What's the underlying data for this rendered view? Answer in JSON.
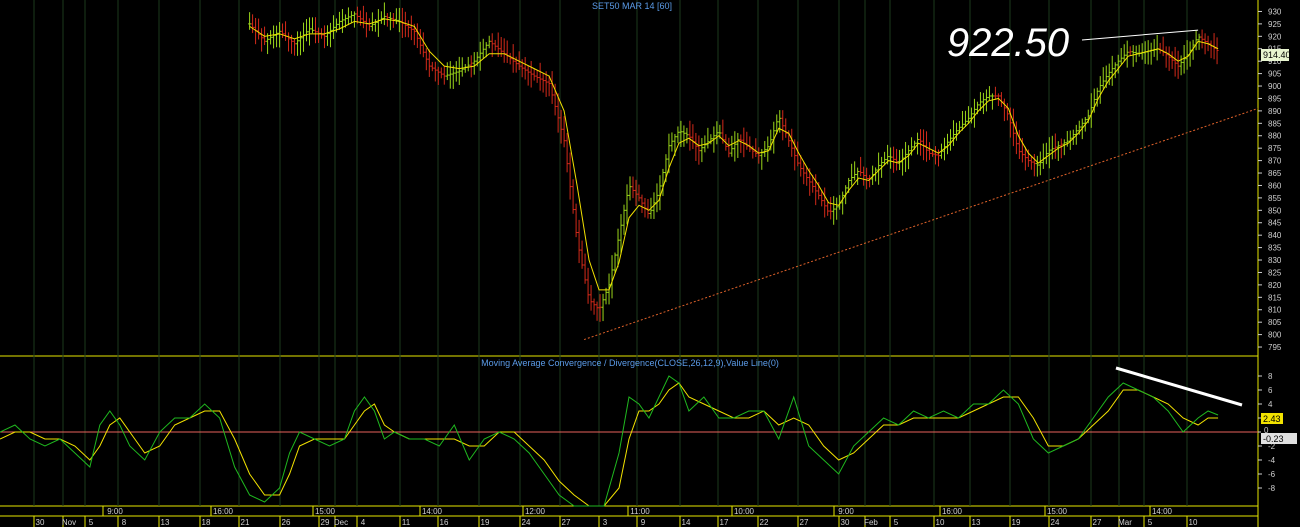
{
  "price_panel": {
    "title": "SET50 MAR 14  [60]",
    "last_value": "914.40",
    "annotation": "922.50"
  },
  "macd_panel": {
    "title": "Moving Average Convergence / Divergence(CLOSE,26,12,9),Value Line(0)",
    "macd_value": "2.43",
    "signal_value": "0",
    "hist_value": "-0.23"
  },
  "colors": {
    "background": "#000000",
    "up_bar": "#9ad51a",
    "down_bar": "#d42a1a",
    "ma_line": "#f2e200",
    "trendline": "#e0622a",
    "macd_line": "#1fb81f",
    "signal_line": "#f2e200",
    "zero_line": "#e8625c",
    "panel_border": "#e6e600",
    "grid": "#1c3a1c",
    "axis_text": "#d0d0d0",
    "title_text": "#5b9be8"
  },
  "chart_data": [
    {
      "type": "line",
      "title": "SET50 MAR 14  [60]",
      "y_ticks": [
        795,
        800,
        805,
        810,
        815,
        820,
        825,
        830,
        835,
        840,
        845,
        850,
        855,
        860,
        865,
        870,
        875,
        880,
        885,
        890,
        895,
        900,
        905,
        910,
        915,
        920,
        925,
        930
      ],
      "ylim": [
        793,
        933
      ],
      "x_domain": [
        0,
        1260
      ],
      "series": [
        {
          "name": "",
          "role": "close",
          "x": [
            250,
            265,
            280,
            295,
            310,
            325,
            340,
            355,
            370,
            385,
            400,
            415,
            430,
            445,
            460,
            475,
            490,
            505,
            520,
            535,
            550,
            565,
            578,
            590,
            600,
            610,
            620,
            630,
            640,
            650,
            660,
            670,
            680,
            690,
            700,
            710,
            720,
            730,
            740,
            750,
            760,
            770,
            780,
            790,
            800,
            810,
            820,
            830,
            840,
            850,
            860,
            870,
            880,
            890,
            900,
            910,
            920,
            930,
            940,
            950,
            960,
            970,
            980,
            990,
            1000,
            1010,
            1020,
            1030,
            1040,
            1050,
            1060,
            1070,
            1080,
            1090,
            1100,
            1110,
            1120,
            1130,
            1140,
            1150,
            1160,
            1170,
            1180,
            1190,
            1200,
            1210,
            1220
          ],
          "y": [
            925,
            918,
            922,
            917,
            923,
            920,
            926,
            929,
            924,
            928,
            926,
            922,
            908,
            904,
            906,
            910,
            918,
            913,
            908,
            904,
            901,
            878,
            838,
            814,
            810,
            820,
            840,
            860,
            855,
            848,
            858,
            876,
            882,
            880,
            874,
            878,
            882,
            873,
            879,
            875,
            872,
            876,
            888,
            878,
            868,
            862,
            856,
            849,
            852,
            862,
            866,
            862,
            868,
            872,
            869,
            874,
            879,
            873,
            872,
            878,
            883,
            887,
            893,
            896,
            896,
            888,
            874,
            870,
            868,
            874,
            876,
            878,
            883,
            888,
            899,
            905,
            910,
            914,
            913,
            914,
            915,
            912,
            908,
            913,
            920,
            917,
            914
          ]
        },
        {
          "name": "",
          "role": "moving-average",
          "x": [
            250,
            265,
            280,
            295,
            310,
            325,
            340,
            355,
            370,
            385,
            400,
            415,
            430,
            445,
            460,
            475,
            490,
            505,
            520,
            535,
            550,
            565,
            578,
            590,
            600,
            610,
            620,
            630,
            640,
            650,
            660,
            670,
            680,
            690,
            700,
            710,
            720,
            730,
            740,
            750,
            760,
            770,
            780,
            790,
            800,
            810,
            820,
            830,
            840,
            850,
            860,
            870,
            880,
            890,
            900,
            910,
            920,
            930,
            940,
            950,
            960,
            970,
            980,
            990,
            1000,
            1010,
            1020,
            1030,
            1040,
            1050,
            1060,
            1070,
            1080,
            1090,
            1100,
            1110,
            1120,
            1130,
            1140,
            1150,
            1160,
            1170,
            1180,
            1190,
            1200,
            1210,
            1220
          ],
          "y": [
            924,
            920,
            921,
            919,
            921,
            921,
            923,
            926,
            925,
            927,
            926,
            924,
            914,
            908,
            907,
            908,
            913,
            913,
            910,
            907,
            904,
            890,
            860,
            830,
            818,
            818,
            829,
            847,
            852,
            850,
            854,
            867,
            877,
            879,
            876,
            877,
            880,
            876,
            878,
            876,
            873,
            874,
            883,
            881,
            873,
            866,
            860,
            853,
            852,
            858,
            863,
            862,
            866,
            870,
            869,
            872,
            877,
            875,
            873,
            876,
            881,
            885,
            890,
            894,
            895,
            891,
            880,
            873,
            869,
            872,
            875,
            877,
            881,
            886,
            895,
            902,
            907,
            912,
            913,
            914,
            915,
            913,
            910,
            912,
            918,
            917,
            915
          ]
        },
        {
          "name": "",
          "role": "trendline",
          "x": [
            585,
            1260
          ],
          "y": [
            798,
            891
          ]
        }
      ]
    },
    {
      "type": "line",
      "title": "Moving Average Convergence / Divergence(CLOSE,26,12,9),Value Line(0)",
      "y_ticks": [
        -8,
        -6,
        -4,
        -2,
        0,
        2,
        4,
        6,
        8
      ],
      "ylim": [
        -10,
        10
      ],
      "x_domain": [
        0,
        1260
      ],
      "series": [
        {
          "name": "",
          "role": "macd",
          "x": [
            0,
            15,
            30,
            45,
            60,
            75,
            90,
            100,
            110,
            120,
            130,
            145,
            160,
            175,
            190,
            205,
            220,
            235,
            250,
            265,
            280,
            290,
            300,
            315,
            330,
            345,
            355,
            365,
            375,
            385,
            395,
            410,
            425,
            440,
            455,
            470,
            485,
            500,
            515,
            530,
            545,
            560,
            575,
            590,
            605,
            620,
            630,
            640,
            650,
            660,
            670,
            680,
            690,
            705,
            720,
            735,
            750,
            765,
            780,
            795,
            810,
            825,
            840,
            855,
            870,
            885,
            900,
            915,
            930,
            945,
            960,
            975,
            990,
            1005,
            1020,
            1035,
            1050,
            1065,
            1080,
            1095,
            1110,
            1125,
            1140,
            1155,
            1170,
            1185,
            1200,
            1210,
            1220
          ],
          "y": [
            0,
            1,
            -1,
            -2,
            -1,
            -3,
            -5,
            1,
            3,
            1,
            -2,
            -4,
            0,
            2,
            2,
            4,
            2,
            -5,
            -9,
            -10,
            -8,
            -3,
            0,
            -1,
            -2,
            -1,
            3,
            5,
            3,
            -1,
            0,
            -1,
            -1,
            -2,
            1,
            -4,
            -1,
            0,
            -1,
            -3,
            -6,
            -9,
            -11,
            -13,
            -12,
            -3,
            5,
            4,
            2,
            5,
            8,
            7,
            3,
            5,
            2,
            2,
            3,
            3,
            -1,
            5,
            -2,
            -4,
            -6,
            -2,
            0,
            2,
            1,
            3,
            2,
            3,
            2,
            4,
            4,
            6,
            4,
            -1,
            -3,
            -2,
            -1,
            2,
            5,
            7,
            6,
            5,
            3,
            0,
            2,
            3,
            2.43
          ]
        },
        {
          "name": "",
          "role": "signal",
          "x": [
            0,
            15,
            30,
            45,
            60,
            75,
            90,
            100,
            110,
            120,
            130,
            145,
            160,
            175,
            190,
            205,
            220,
            235,
            250,
            265,
            280,
            290,
            300,
            315,
            330,
            345,
            355,
            365,
            375,
            385,
            395,
            410,
            425,
            440,
            455,
            470,
            485,
            500,
            515,
            530,
            545,
            560,
            575,
            590,
            605,
            620,
            630,
            640,
            650,
            660,
            670,
            680,
            690,
            705,
            720,
            735,
            750,
            765,
            780,
            795,
            810,
            825,
            840,
            855,
            870,
            885,
            900,
            915,
            930,
            945,
            960,
            975,
            990,
            1005,
            1020,
            1035,
            1050,
            1065,
            1080,
            1095,
            1110,
            1125,
            1140,
            1155,
            1170,
            1185,
            1200,
            1210,
            1220
          ],
          "y": [
            -1,
            0,
            0,
            -1,
            -1,
            -2,
            -4,
            -2,
            1,
            2,
            0,
            -3,
            -2,
            1,
            2,
            3,
            3,
            -1,
            -6,
            -9,
            -9,
            -6,
            -2,
            -1,
            -1,
            -1,
            1,
            3,
            4,
            1,
            0,
            -1,
            -1,
            -1,
            -1,
            -2,
            -2,
            0,
            0,
            -2,
            -4,
            -7,
            -9,
            -11,
            -12,
            -8,
            -1,
            3,
            3,
            4,
            6,
            7,
            5,
            4,
            3,
            2,
            2,
            3,
            1,
            2,
            1,
            -2,
            -4,
            -3,
            -1,
            1,
            1,
            2,
            2,
            2,
            2,
            3,
            4,
            5,
            5,
            2,
            -2,
            -2,
            -1,
            1,
            3,
            6,
            6,
            5,
            4,
            2,
            1,
            2,
            2
          ]
        }
      ],
      "zero_line": 0
    }
  ],
  "date_axis": {
    "labels": [
      {
        "x": 40,
        "text": "30"
      },
      {
        "x": 69,
        "text": "Nov"
      },
      {
        "x": 91,
        "text": "5"
      },
      {
        "x": 124,
        "text": "8"
      },
      {
        "x": 165,
        "text": "13"
      },
      {
        "x": 206,
        "text": "18"
      },
      {
        "x": 245,
        "text": "21"
      },
      {
        "x": 286,
        "text": "26"
      },
      {
        "x": 325,
        "text": "29"
      },
      {
        "x": 341,
        "text": "Dec"
      },
      {
        "x": 363,
        "text": "4"
      },
      {
        "x": 406,
        "text": "11"
      },
      {
        "x": 444,
        "text": "16"
      },
      {
        "x": 485,
        "text": "19"
      },
      {
        "x": 526,
        "text": "24"
      },
      {
        "x": 566,
        "text": "27"
      },
      {
        "x": 605,
        "text": "3"
      },
      {
        "x": 643,
        "text": "9"
      },
      {
        "x": 686,
        "text": "14"
      },
      {
        "x": 724,
        "text": "17"
      },
      {
        "x": 764,
        "text": "22"
      },
      {
        "x": 804,
        "text": "27"
      },
      {
        "x": 845,
        "text": "30"
      },
      {
        "x": 871,
        "text": "Feb"
      },
      {
        "x": 896,
        "text": "5"
      },
      {
        "x": 940,
        "text": "10"
      },
      {
        "x": 976,
        "text": "13"
      },
      {
        "x": 1016,
        "text": "19"
      },
      {
        "x": 1055,
        "text": "24"
      },
      {
        "x": 1097,
        "text": "27"
      },
      {
        "x": 1125,
        "text": "Mar"
      },
      {
        "x": 1150,
        "text": "5"
      },
      {
        "x": 1193,
        "text": "10"
      }
    ],
    "time_labels": [
      {
        "x": 115,
        "text": "9:00"
      },
      {
        "x": 223,
        "text": "16:00"
      },
      {
        "x": 325,
        "text": "15:00"
      },
      {
        "x": 432,
        "text": "14:00"
      },
      {
        "x": 535,
        "text": "12:00"
      },
      {
        "x": 640,
        "text": "11:00"
      },
      {
        "x": 744,
        "text": "10:00"
      },
      {
        "x": 846,
        "text": "9:00"
      },
      {
        "x": 952,
        "text": "16:00"
      },
      {
        "x": 1057,
        "text": "15:00"
      },
      {
        "x": 1162,
        "text": "14:00"
      }
    ]
  }
}
